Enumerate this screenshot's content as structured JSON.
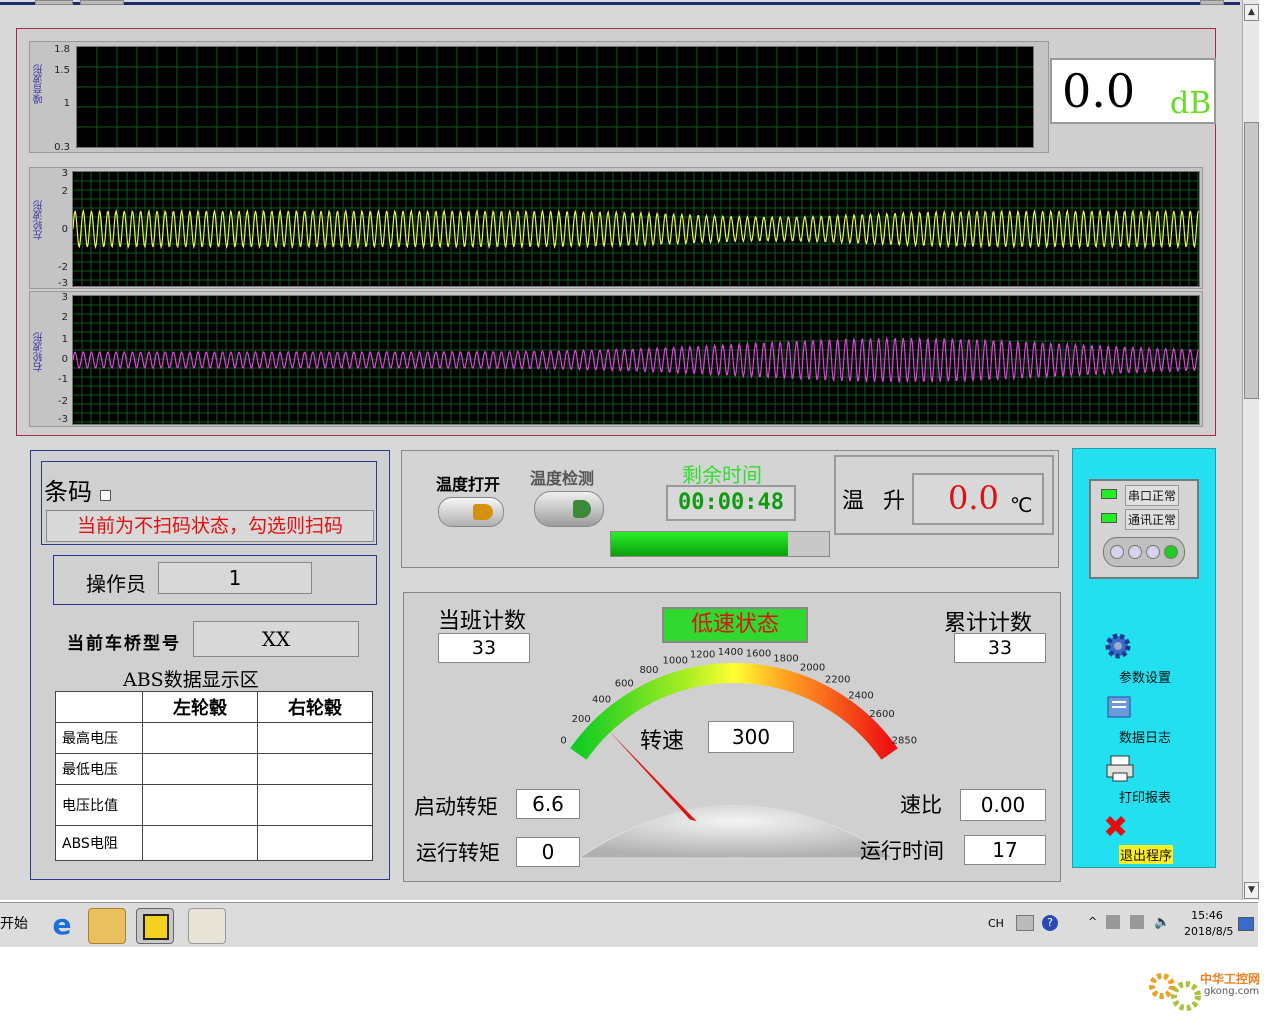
{
  "noise_chart": {
    "ylabel": "噪音波形",
    "yticks": [
      "1.8",
      "1.5",
      "1",
      "0.3"
    ],
    "ylim": [
      0.3,
      1.8
    ]
  },
  "noise_display": {
    "value": "0.0",
    "unit": "dB"
  },
  "left_wheel_chart": {
    "ylabel": "左轮波形",
    "yticks": [
      "3",
      "2",
      "0",
      "-2",
      "-3"
    ],
    "color": "#e8f060"
  },
  "right_wheel_chart": {
    "ylabel": "右轮波形",
    "yticks": [
      "3",
      "2",
      "1",
      "0",
      "-1",
      "-2",
      "-3"
    ],
    "color": "#e040e0"
  },
  "barcode": {
    "label": "条码",
    "status": "当前为不扫码状态，勾选则扫码"
  },
  "operator": {
    "label": "操作员",
    "value": "1"
  },
  "axle_model": {
    "label": "当前车桥型号",
    "value": "XX"
  },
  "abs": {
    "title": "ABS数据显示区",
    "columns": [
      "左轮毂",
      "右轮毂"
    ],
    "rows": [
      "最高电压",
      "最低电压",
      "电压比值",
      "ABS电阻"
    ]
  },
  "temp_controls": {
    "open_label": "温度打开",
    "detect_label": "温度检测",
    "remaining_label": "剩余时间",
    "remaining_value": "00:00:48",
    "progress": 0.81
  },
  "temp_rise": {
    "label": "温 升",
    "value": "0.0",
    "unit": "℃"
  },
  "gauge": {
    "shift_count_label": "当班计数",
    "shift_count": "33",
    "state": "低速状态",
    "total_count_label": "累计计数",
    "total_count": "33",
    "speed_label": "转速",
    "speed": "300",
    "ticks": [
      "0",
      "200",
      "400",
      "600",
      "800",
      "1000",
      "1200",
      "1400",
      "1600",
      "1800",
      "2000",
      "2200",
      "2400",
      "2600",
      "2850"
    ],
    "max": 2850,
    "needle_value": 300,
    "start_torque_label": "启动转矩",
    "start_torque": "6.6",
    "run_torque_label": "运行转矩",
    "run_torque": "0",
    "ratio_label": "速比",
    "ratio": "0.00",
    "run_time_label": "运行时间",
    "run_time": "17"
  },
  "status": {
    "serial": "串口正常",
    "comm": "通讯正常"
  },
  "sidebar": {
    "settings": "参数设置",
    "log": "数据日志",
    "print": "打印报表",
    "exit": "退出程序"
  },
  "taskbar": {
    "start": "开始",
    "lang": "CH",
    "time": "15:46",
    "date": "2018/8/5"
  },
  "watermark": {
    "name": "中华工控网",
    "url": "gkong.com"
  }
}
